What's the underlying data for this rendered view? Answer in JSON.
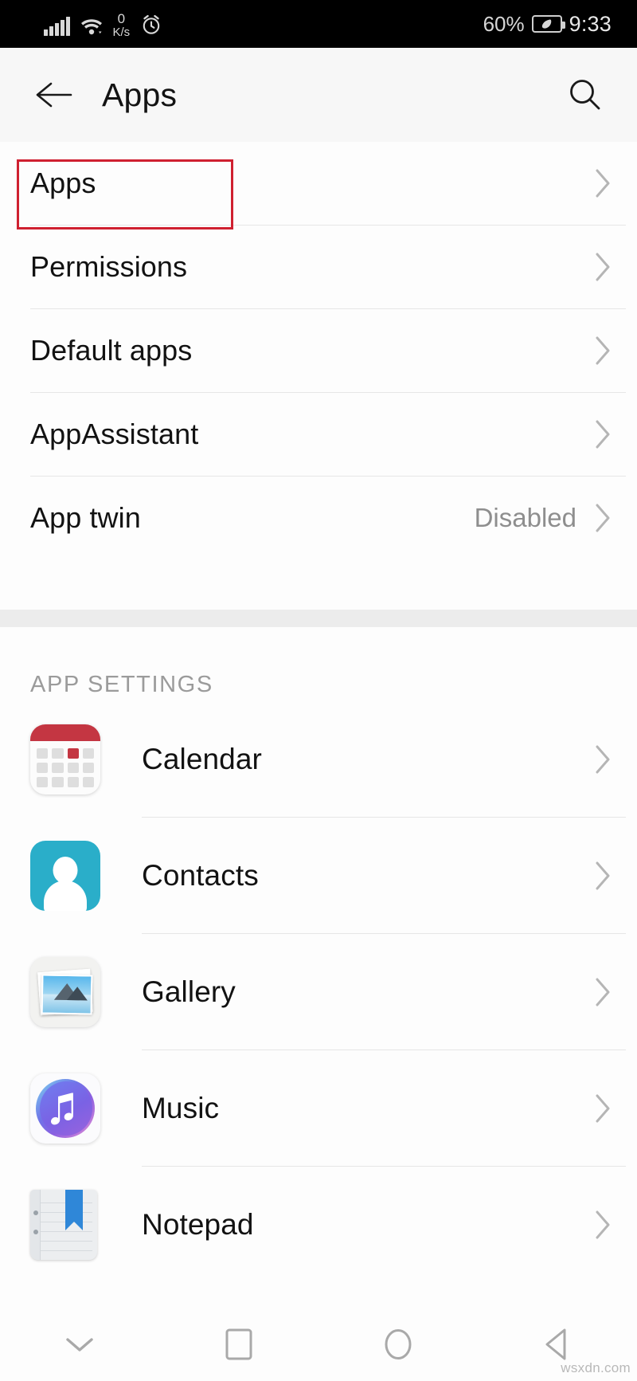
{
  "statusbar": {
    "network_speed_value": "0",
    "network_speed_unit": "K/s",
    "battery_percent": "60%",
    "time": "9:33",
    "icons": [
      "signal-icon",
      "wifi-icon",
      "network-speed-icon",
      "alarm-icon",
      "battery-icon"
    ]
  },
  "appbar": {
    "title": "Apps",
    "back_icon": "back-arrow-icon",
    "search_icon": "search-icon"
  },
  "settings_rows": [
    {
      "label": "Apps",
      "value": "",
      "highlighted": true
    },
    {
      "label": "Permissions",
      "value": "",
      "highlighted": false
    },
    {
      "label": "Default apps",
      "value": "",
      "highlighted": false
    },
    {
      "label": "AppAssistant",
      "value": "",
      "highlighted": false
    },
    {
      "label": "App twin",
      "value": "Disabled",
      "highlighted": false
    }
  ],
  "app_settings": {
    "header": "APP SETTINGS",
    "items": [
      {
        "label": "Calendar",
        "icon": "calendar-app-icon"
      },
      {
        "label": "Contacts",
        "icon": "contacts-app-icon"
      },
      {
        "label": "Gallery",
        "icon": "gallery-app-icon"
      },
      {
        "label": "Music",
        "icon": "music-app-icon"
      },
      {
        "label": "Notepad",
        "icon": "notepad-app-icon"
      }
    ]
  },
  "navbar": {
    "buttons": [
      {
        "name": "collapse-keyboard-button",
        "icon": "chevron-down-icon"
      },
      {
        "name": "recents-button",
        "icon": "square-icon"
      },
      {
        "name": "home-button",
        "icon": "circle-icon"
      },
      {
        "name": "back-button",
        "icon": "triangle-left-icon"
      }
    ]
  },
  "watermark": "wsxdn.com",
  "colors": {
    "highlight_box": "#cf2030",
    "calendar_red": "#c43642",
    "contacts_teal": "#2aaec9",
    "notepad_blue": "#2f87d8",
    "appbar_bg": "#f7f7f7",
    "band_bg": "#ececec"
  }
}
